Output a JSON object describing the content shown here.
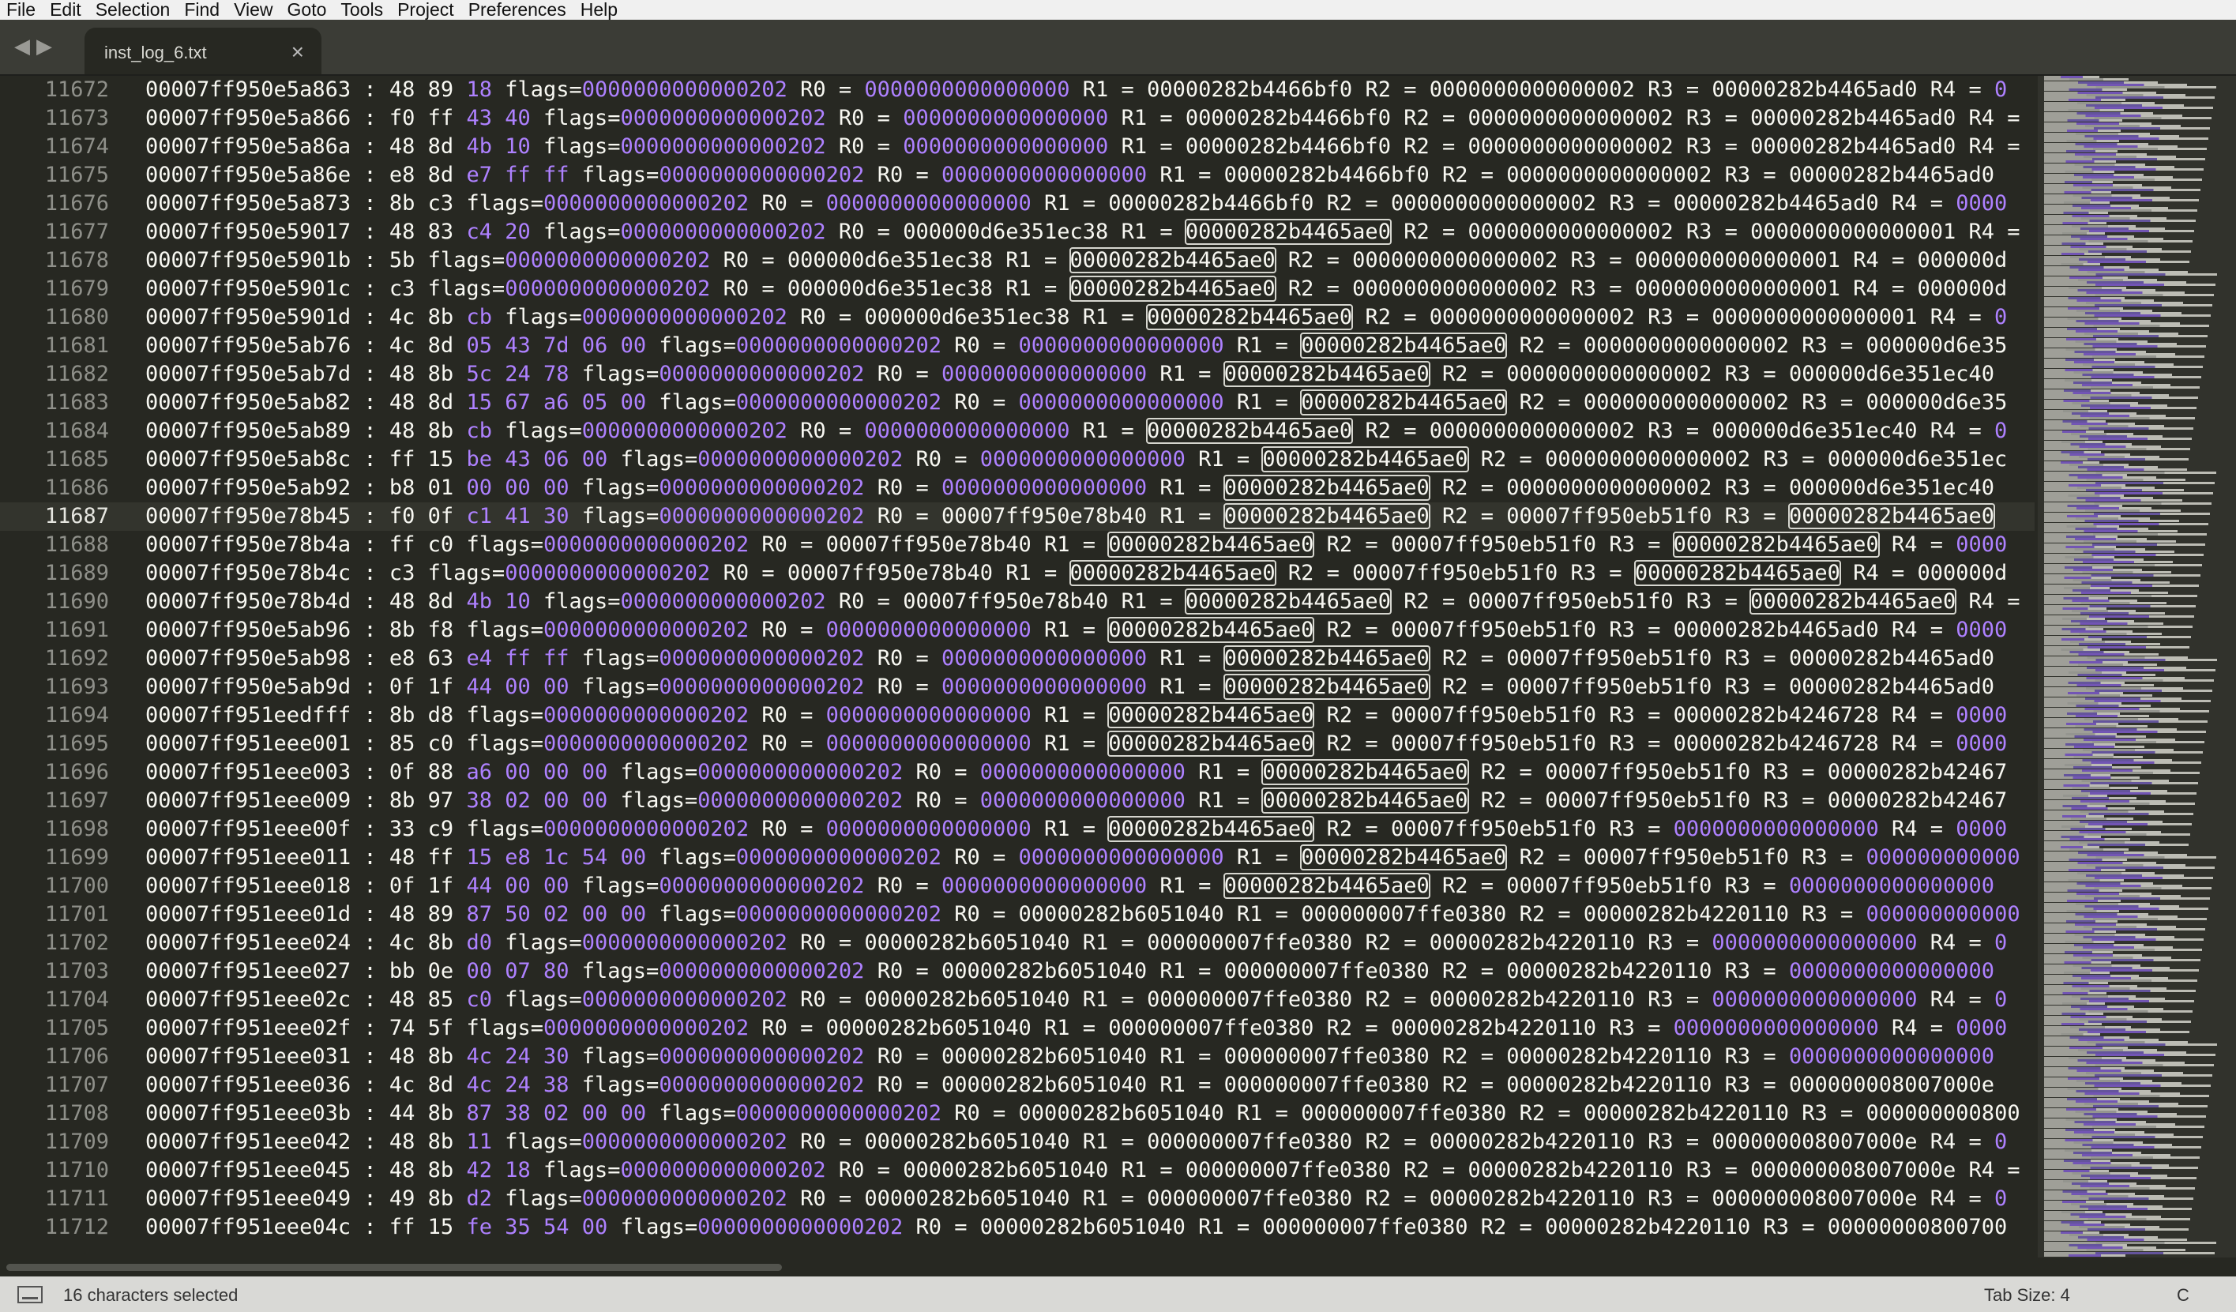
{
  "menu": [
    "File",
    "Edit",
    "Selection",
    "Find",
    "View",
    "Goto",
    "Tools",
    "Project",
    "Preferences",
    "Help"
  ],
  "tab": {
    "title": "inst_log_6.txt",
    "close": "×"
  },
  "nav": {
    "back": "◀",
    "forward": "▶"
  },
  "status": {
    "text": "16 characters selected",
    "tab_size": "Tab Size: 4",
    "syntax": "C"
  },
  "current_line": "11687",
  "lines": [
    {
      "n": "11672",
      "addr": "00007ff950e5a863",
      "bytes": "48 89 18",
      "flags": "0000000000000202",
      "regs": [
        [
          "R0",
          "0000000000000000"
        ],
        [
          "R1",
          "00000282b4466bf0"
        ],
        [
          "R2",
          "0000000000000002"
        ],
        [
          "R3",
          "00000282b4465ad0"
        ],
        [
          "R4",
          "0"
        ]
      ]
    },
    {
      "n": "11673",
      "addr": "00007ff950e5a866",
      "bytes": "f0 ff 43 40",
      "flags": "0000000000000202",
      "regs": [
        [
          "R0",
          "0000000000000000"
        ],
        [
          "R1",
          "00000282b4466bf0"
        ],
        [
          "R2",
          "0000000000000002"
        ],
        [
          "R3",
          "00000282b4465ad0"
        ],
        [
          "R4",
          ""
        ]
      ]
    },
    {
      "n": "11674",
      "addr": "00007ff950e5a86a",
      "bytes": "48 8d 4b 10",
      "flags": "0000000000000202",
      "regs": [
        [
          "R0",
          "0000000000000000"
        ],
        [
          "R1",
          "00000282b4466bf0"
        ],
        [
          "R2",
          "0000000000000002"
        ],
        [
          "R3",
          "00000282b4465ad0"
        ],
        [
          "R4",
          ""
        ]
      ]
    },
    {
      "n": "11675",
      "addr": "00007ff950e5a86e",
      "bytes": "e8 8d e7 ff ff",
      "flags": "0000000000000202",
      "regs": [
        [
          "R0",
          "0000000000000000"
        ],
        [
          "R1",
          "00000282b4466bf0"
        ],
        [
          "R2",
          "0000000000000002"
        ],
        [
          "R3",
          "00000282b4465ad0"
        ]
      ]
    },
    {
      "n": "11676",
      "addr": "00007ff950e5a873",
      "bytes": "8b c3",
      "flags": "0000000000000202",
      "regs": [
        [
          "R0",
          "0000000000000000"
        ],
        [
          "R1",
          "00000282b4466bf0"
        ],
        [
          "R2",
          "0000000000000002"
        ],
        [
          "R3",
          "00000282b4465ad0"
        ],
        [
          "R4",
          "0000"
        ]
      ]
    },
    {
      "n": "11677",
      "addr": "00007ff950e59017",
      "bytes": "48 83 c4 20",
      "flags": "0000000000000202",
      "regs": [
        [
          "R0",
          "000000d6e351ec38"
        ],
        [
          "R1",
          "00000282b4465ae0"
        ],
        [
          "R2",
          "0000000000000002"
        ],
        [
          "R3",
          "0000000000000001"
        ],
        [
          "R4",
          ""
        ]
      ]
    },
    {
      "n": "11678",
      "addr": "00007ff950e5901b",
      "bytes": "5b",
      "flags": "0000000000000202",
      "regs": [
        [
          "R0",
          "000000d6e351ec38"
        ],
        [
          "R1",
          "00000282b4465ae0"
        ],
        [
          "R2",
          "0000000000000002"
        ],
        [
          "R3",
          "0000000000000001"
        ],
        [
          "R4",
          "000000d"
        ]
      ]
    },
    {
      "n": "11679",
      "addr": "00007ff950e5901c",
      "bytes": "c3",
      "flags": "0000000000000202",
      "regs": [
        [
          "R0",
          "000000d6e351ec38"
        ],
        [
          "R1",
          "00000282b4465ae0"
        ],
        [
          "R2",
          "0000000000000002"
        ],
        [
          "R3",
          "0000000000000001"
        ],
        [
          "R4",
          "000000d"
        ]
      ]
    },
    {
      "n": "11680",
      "addr": "00007ff950e5901d",
      "bytes": "4c 8b cb",
      "flags": "0000000000000202",
      "regs": [
        [
          "R0",
          "000000d6e351ec38"
        ],
        [
          "R1",
          "00000282b4465ae0"
        ],
        [
          "R2",
          "0000000000000002"
        ],
        [
          "R3",
          "0000000000000001"
        ],
        [
          "R4",
          "0"
        ]
      ]
    },
    {
      "n": "11681",
      "addr": "00007ff950e5ab76",
      "bytes": "4c 8d 05 43 7d 06 00",
      "flags": "0000000000000202",
      "regs": [
        [
          "R0",
          "0000000000000000"
        ],
        [
          "R1",
          "00000282b4465ae0"
        ],
        [
          "R2",
          "0000000000000002"
        ],
        [
          "R3",
          "000000d6e35"
        ]
      ]
    },
    {
      "n": "11682",
      "addr": "00007ff950e5ab7d",
      "bytes": "48 8b 5c 24 78",
      "flags": "0000000000000202",
      "regs": [
        [
          "R0",
          "0000000000000000"
        ],
        [
          "R1",
          "00000282b4465ae0"
        ],
        [
          "R2",
          "0000000000000002"
        ],
        [
          "R3",
          "000000d6e351ec40"
        ]
      ]
    },
    {
      "n": "11683",
      "addr": "00007ff950e5ab82",
      "bytes": "48 8d 15 67 a6 05 00",
      "flags": "0000000000000202",
      "regs": [
        [
          "R0",
          "0000000000000000"
        ],
        [
          "R1",
          "00000282b4465ae0"
        ],
        [
          "R2",
          "0000000000000002"
        ],
        [
          "R3",
          "000000d6e35"
        ]
      ]
    },
    {
      "n": "11684",
      "addr": "00007ff950e5ab89",
      "bytes": "48 8b cb",
      "flags": "0000000000000202",
      "regs": [
        [
          "R0",
          "0000000000000000"
        ],
        [
          "R1",
          "00000282b4465ae0"
        ],
        [
          "R2",
          "0000000000000002"
        ],
        [
          "R3",
          "000000d6e351ec40"
        ],
        [
          "R4",
          "0"
        ]
      ]
    },
    {
      "n": "11685",
      "addr": "00007ff950e5ab8c",
      "bytes": "ff 15 be 43 06 00",
      "flags": "0000000000000202",
      "regs": [
        [
          "R0",
          "0000000000000000"
        ],
        [
          "R1",
          "00000282b4465ae0"
        ],
        [
          "R2",
          "0000000000000002"
        ],
        [
          "R3",
          "000000d6e351ec"
        ]
      ]
    },
    {
      "n": "11686",
      "addr": "00007ff950e5ab92",
      "bytes": "b8 01 00 00 00",
      "flags": "0000000000000202",
      "regs": [
        [
          "R0",
          "0000000000000000"
        ],
        [
          "R1",
          "00000282b4465ae0"
        ],
        [
          "R2",
          "0000000000000002"
        ],
        [
          "R3",
          "000000d6e351ec40"
        ]
      ]
    },
    {
      "n": "11687",
      "addr": "00007ff950e78b45",
      "bytes": "f0 0f c1 41 30",
      "flags": "0000000000000202",
      "regs": [
        [
          "R0",
          "00007ff950e78b40"
        ],
        [
          "R1",
          "00000282b4465ae0"
        ],
        [
          "R2",
          "00007ff950eb51f0"
        ],
        [
          "R3",
          "00000282b4465ae0"
        ]
      ]
    },
    {
      "n": "11688",
      "addr": "00007ff950e78b4a",
      "bytes": "ff c0",
      "flags": "0000000000000202",
      "regs": [
        [
          "R0",
          "00007ff950e78b40"
        ],
        [
          "R1",
          "00000282b4465ae0"
        ],
        [
          "R2",
          "00007ff950eb51f0"
        ],
        [
          "R3",
          "00000282b4465ae0"
        ],
        [
          "R4",
          "0000"
        ]
      ]
    },
    {
      "n": "11689",
      "addr": "00007ff950e78b4c",
      "bytes": "c3",
      "flags": "0000000000000202",
      "regs": [
        [
          "R0",
          "00007ff950e78b40"
        ],
        [
          "R1",
          "00000282b4465ae0"
        ],
        [
          "R2",
          "00007ff950eb51f0"
        ],
        [
          "R3",
          "00000282b4465ae0"
        ],
        [
          "R4",
          "000000d"
        ]
      ]
    },
    {
      "n": "11690",
      "addr": "00007ff950e78b4d",
      "bytes": "48 8d 4b 10",
      "flags": "0000000000000202",
      "regs": [
        [
          "R0",
          "00007ff950e78b40"
        ],
        [
          "R1",
          "00000282b4465ae0"
        ],
        [
          "R2",
          "00007ff950eb51f0"
        ],
        [
          "R3",
          "00000282b4465ae0"
        ],
        [
          "R4",
          ""
        ]
      ]
    },
    {
      "n": "11691",
      "addr": "00007ff950e5ab96",
      "bytes": "8b f8",
      "flags": "0000000000000202",
      "regs": [
        [
          "R0",
          "0000000000000000"
        ],
        [
          "R1",
          "00000282b4465ae0"
        ],
        [
          "R2",
          "00007ff950eb51f0"
        ],
        [
          "R3",
          "00000282b4465ad0"
        ],
        [
          "R4",
          "0000"
        ]
      ]
    },
    {
      "n": "11692",
      "addr": "00007ff950e5ab98",
      "bytes": "e8 63 e4 ff ff",
      "flags": "0000000000000202",
      "regs": [
        [
          "R0",
          "0000000000000000"
        ],
        [
          "R1",
          "00000282b4465ae0"
        ],
        [
          "R2",
          "00007ff950eb51f0"
        ],
        [
          "R3",
          "00000282b4465ad0"
        ]
      ]
    },
    {
      "n": "11693",
      "addr": "00007ff950e5ab9d",
      "bytes": "0f 1f 44 00 00",
      "flags": "0000000000000202",
      "regs": [
        [
          "R0",
          "0000000000000000"
        ],
        [
          "R1",
          "00000282b4465ae0"
        ],
        [
          "R2",
          "00007ff950eb51f0"
        ],
        [
          "R3",
          "00000282b4465ad0"
        ]
      ]
    },
    {
      "n": "11694",
      "addr": "00007ff951eedfff",
      "bytes": "8b d8",
      "flags": "0000000000000202",
      "regs": [
        [
          "R0",
          "0000000000000000"
        ],
        [
          "R1",
          "00000282b4465ae0"
        ],
        [
          "R2",
          "00007ff950eb51f0"
        ],
        [
          "R3",
          "00000282b4246728"
        ],
        [
          "R4",
          "0000"
        ]
      ]
    },
    {
      "n": "11695",
      "addr": "00007ff951eee001",
      "bytes": "85 c0",
      "flags": "0000000000000202",
      "regs": [
        [
          "R0",
          "0000000000000000"
        ],
        [
          "R1",
          "00000282b4465ae0"
        ],
        [
          "R2",
          "00007ff950eb51f0"
        ],
        [
          "R3",
          "00000282b4246728"
        ],
        [
          "R4",
          "0000"
        ]
      ]
    },
    {
      "n": "11696",
      "addr": "00007ff951eee003",
      "bytes": "0f 88 a6 00 00 00",
      "flags": "0000000000000202",
      "regs": [
        [
          "R0",
          "0000000000000000"
        ],
        [
          "R1",
          "00000282b4465ae0"
        ],
        [
          "R2",
          "00007ff950eb51f0"
        ],
        [
          "R3",
          "00000282b42467"
        ]
      ]
    },
    {
      "n": "11697",
      "addr": "00007ff951eee009",
      "bytes": "8b 97 38 02 00 00",
      "flags": "0000000000000202",
      "regs": [
        [
          "R0",
          "0000000000000000"
        ],
        [
          "R1",
          "00000282b4465ae0"
        ],
        [
          "R2",
          "00007ff950eb51f0"
        ],
        [
          "R3",
          "00000282b42467"
        ]
      ]
    },
    {
      "n": "11698",
      "addr": "00007ff951eee00f",
      "bytes": "33 c9",
      "flags": "0000000000000202",
      "regs": [
        [
          "R0",
          "0000000000000000"
        ],
        [
          "R1",
          "00000282b4465ae0"
        ],
        [
          "R2",
          "00007ff950eb51f0"
        ],
        [
          "R3",
          "0000000000000000"
        ],
        [
          "R4",
          "0000"
        ]
      ]
    },
    {
      "n": "11699",
      "addr": "00007ff951eee011",
      "bytes": "48 ff 15 e8 1c 54 00",
      "flags": "0000000000000202",
      "regs": [
        [
          "R0",
          "0000000000000000"
        ],
        [
          "R1",
          "00000282b4465ae0"
        ],
        [
          "R2",
          "00007ff950eb51f0"
        ],
        [
          "R3",
          "000000000000"
        ]
      ]
    },
    {
      "n": "11700",
      "addr": "00007ff951eee018",
      "bytes": "0f 1f 44 00 00",
      "flags": "0000000000000202",
      "regs": [
        [
          "R0",
          "0000000000000000"
        ],
        [
          "R1",
          "00000282b4465ae0"
        ],
        [
          "R2",
          "00007ff950eb51f0"
        ],
        [
          "R3",
          "0000000000000000"
        ]
      ]
    },
    {
      "n": "11701",
      "addr": "00007ff951eee01d",
      "bytes": "48 89 87 50 02 00 00",
      "flags": "0000000000000202",
      "regs": [
        [
          "R0",
          "00000282b6051040"
        ],
        [
          "R1",
          "000000007ffe0380"
        ],
        [
          "R2",
          "00000282b4220110"
        ],
        [
          "R3",
          "000000000000"
        ]
      ]
    },
    {
      "n": "11702",
      "addr": "00007ff951eee024",
      "bytes": "4c 8b d0",
      "flags": "0000000000000202",
      "regs": [
        [
          "R0",
          "00000282b6051040"
        ],
        [
          "R1",
          "000000007ffe0380"
        ],
        [
          "R2",
          "00000282b4220110"
        ],
        [
          "R3",
          "0000000000000000"
        ],
        [
          "R4",
          "0"
        ]
      ]
    },
    {
      "n": "11703",
      "addr": "00007ff951eee027",
      "bytes": "bb 0e 00 07 80",
      "flags": "0000000000000202",
      "regs": [
        [
          "R0",
          "00000282b6051040"
        ],
        [
          "R1",
          "000000007ffe0380"
        ],
        [
          "R2",
          "00000282b4220110"
        ],
        [
          "R3",
          "0000000000000000"
        ]
      ]
    },
    {
      "n": "11704",
      "addr": "00007ff951eee02c",
      "bytes": "48 85 c0",
      "flags": "0000000000000202",
      "regs": [
        [
          "R0",
          "00000282b6051040"
        ],
        [
          "R1",
          "000000007ffe0380"
        ],
        [
          "R2",
          "00000282b4220110"
        ],
        [
          "R3",
          "0000000000000000"
        ],
        [
          "R4",
          "0"
        ]
      ]
    },
    {
      "n": "11705",
      "addr": "00007ff951eee02f",
      "bytes": "74 5f",
      "flags": "0000000000000202",
      "regs": [
        [
          "R0",
          "00000282b6051040"
        ],
        [
          "R1",
          "000000007ffe0380"
        ],
        [
          "R2",
          "00000282b4220110"
        ],
        [
          "R3",
          "0000000000000000"
        ],
        [
          "R4",
          "0000"
        ]
      ]
    },
    {
      "n": "11706",
      "addr": "00007ff951eee031",
      "bytes": "48 8b 4c 24 30",
      "flags": "0000000000000202",
      "regs": [
        [
          "R0",
          "00000282b6051040"
        ],
        [
          "R1",
          "000000007ffe0380"
        ],
        [
          "R2",
          "00000282b4220110"
        ],
        [
          "R3",
          "0000000000000000"
        ]
      ]
    },
    {
      "n": "11707",
      "addr": "00007ff951eee036",
      "bytes": "4c 8d 4c 24 38",
      "flags": "0000000000000202",
      "regs": [
        [
          "R0",
          "00000282b6051040"
        ],
        [
          "R1",
          "000000007ffe0380"
        ],
        [
          "R2",
          "00000282b4220110"
        ],
        [
          "R3",
          "000000008007000e"
        ]
      ]
    },
    {
      "n": "11708",
      "addr": "00007ff951eee03b",
      "bytes": "44 8b 87 38 02 00 00",
      "flags": "0000000000000202",
      "regs": [
        [
          "R0",
          "00000282b6051040"
        ],
        [
          "R1",
          "000000007ffe0380"
        ],
        [
          "R2",
          "00000282b4220110"
        ],
        [
          "R3",
          "000000000800"
        ]
      ]
    },
    {
      "n": "11709",
      "addr": "00007ff951eee042",
      "bytes": "48 8b 11",
      "flags": "0000000000000202",
      "regs": [
        [
          "R0",
          "00000282b6051040"
        ],
        [
          "R1",
          "000000007ffe0380"
        ],
        [
          "R2",
          "00000282b4220110"
        ],
        [
          "R3",
          "000000008007000e"
        ],
        [
          "R4",
          "0"
        ]
      ]
    },
    {
      "n": "11710",
      "addr": "00007ff951eee045",
      "bytes": "48 8b 42 18",
      "flags": "0000000000000202",
      "regs": [
        [
          "R0",
          "00000282b6051040"
        ],
        [
          "R1",
          "000000007ffe0380"
        ],
        [
          "R2",
          "00000282b4220110"
        ],
        [
          "R3",
          "000000008007000e"
        ],
        [
          "R4",
          ""
        ]
      ]
    },
    {
      "n": "11711",
      "addr": "00007ff951eee049",
      "bytes": "49 8b d2",
      "flags": "0000000000000202",
      "regs": [
        [
          "R0",
          "00000282b6051040"
        ],
        [
          "R1",
          "000000007ffe0380"
        ],
        [
          "R2",
          "00000282b4220110"
        ],
        [
          "R3",
          "000000008007000e"
        ],
        [
          "R4",
          "0"
        ]
      ]
    },
    {
      "n": "11712",
      "addr": "00007ff951eee04c",
      "bytes": "ff 15 fe 35 54 00",
      "flags": "0000000000000202",
      "regs": [
        [
          "R0",
          "00000282b6051040"
        ],
        [
          "R1",
          "000000007ffe0380"
        ],
        [
          "R2",
          "00000282b4220110"
        ],
        [
          "R3",
          "00000000800700"
        ]
      ]
    }
  ]
}
